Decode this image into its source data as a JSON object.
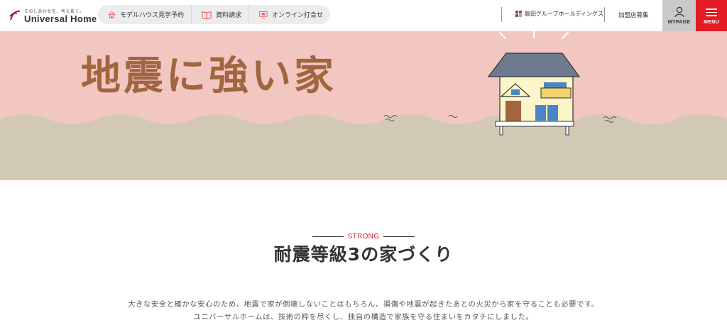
{
  "header": {
    "logo": {
      "tagline": "そのしあわせを、考え抜く。",
      "name": "Universal Home"
    },
    "nav": [
      {
        "label": "モデルハウス見学予約",
        "icon": "house-icon"
      },
      {
        "label": "資料請求",
        "icon": "book-icon"
      },
      {
        "label": "オンライン打合せ",
        "icon": "monitor-icon"
      }
    ],
    "group_link": "飯田グループホールディングス",
    "franchise_link": "加盟店募集",
    "mypage_label": "MYPAGE",
    "menu_label": "MENU"
  },
  "hero": {
    "title": "地震に強い家"
  },
  "section": {
    "eyebrow": "STRONG",
    "title": "耐震等級3の家づくり",
    "paragraph_line1": "大きな安全と確かな安心のため、地震で家が倒壊しないことはもちろん、損傷や地震が起きたあとの火災から家を守ることも必要です。",
    "paragraph_line2": "ユニバーサルホームは、技術の粋を尽くし、独自の構造で家族を守る住まいをカタチにしました。"
  },
  "colors": {
    "accent_red": "#e31b23",
    "hero_pink": "#f2c6c1",
    "ground": "#d2c9b5",
    "title_brown": "#a1663f"
  }
}
